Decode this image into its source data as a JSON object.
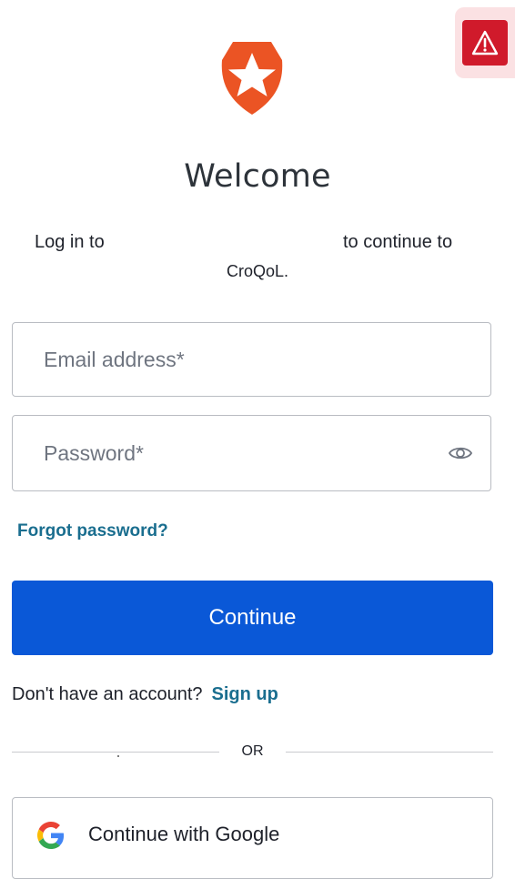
{
  "header": {
    "title": "Welcome",
    "subtitle_prefix": "Log in to",
    "subtitle_suffix": "to continue to",
    "app_name": "CroQoL."
  },
  "alert": {
    "icon": "warning-triangle-icon",
    "color": "#d01a2b"
  },
  "logo": {
    "icon": "auth0-star-shield-icon",
    "color": "#eb5424"
  },
  "form": {
    "email_placeholder": "Email address*",
    "email_value": "",
    "password_placeholder": "Password*",
    "password_value": "",
    "show_password_icon": "eye-icon",
    "forgot_password_label": "Forgot password?",
    "continue_label": "Continue"
  },
  "signup": {
    "prompt": "Don't have an account?",
    "link_label": "Sign up"
  },
  "separator": {
    "label": "OR"
  },
  "social": {
    "google_label": "Continue with Google",
    "google_icon": "google-g-icon"
  },
  "colors": {
    "primary_button": "#0a58d7",
    "link": "#1a6e8f",
    "alert": "#d01a2b"
  }
}
